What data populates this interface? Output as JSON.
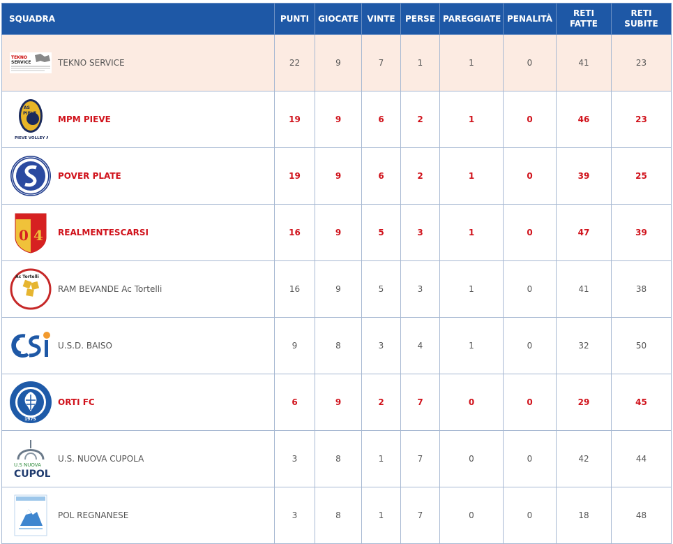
{
  "headers": {
    "team": "SQUADRA",
    "punti": "PUNTI",
    "giocate": "GIOCATE",
    "vinte": "VINTE",
    "perse": "PERSE",
    "pareggiate": "PAREGGIATE",
    "penalita": "PENALITÀ",
    "reti_fatte_1": "RETI",
    "reti_fatte_2": "FATTE",
    "reti_subite_1": "RETI",
    "reti_subite_2": "SUBITE"
  },
  "rows": [
    {
      "team": "TEKNO SERVICE",
      "logo": "tekno-service-logo",
      "punti": "22",
      "giocate": "9",
      "vinte": "7",
      "perse": "1",
      "pareggiate": "1",
      "penalita": "0",
      "reti_fatte": "41",
      "reti_subite": "23",
      "logo_text": "TEKNO SERVICE"
    },
    {
      "team": "MPM PIEVE",
      "logo": "pieve-volley-logo",
      "punti": "19",
      "giocate": "9",
      "vinte": "6",
      "perse": "2",
      "pareggiate": "1",
      "penalita": "0",
      "reti_fatte": "46",
      "reti_subite": "23",
      "logo_text": "PIEVE VOLLEY A.S.D."
    },
    {
      "team": "POVER PLATE",
      "logo": "pover-plate-logo",
      "punti": "19",
      "giocate": "9",
      "vinte": "6",
      "perse": "2",
      "pareggiate": "1",
      "penalita": "0",
      "reti_fatte": "39",
      "reti_subite": "25",
      "logo_text": ""
    },
    {
      "team": "REALMENTESCARSI",
      "logo": "realmentescarsi-logo",
      "punti": "16",
      "giocate": "9",
      "vinte": "5",
      "perse": "3",
      "pareggiate": "1",
      "penalita": "0",
      "reti_fatte": "47",
      "reti_subite": "39",
      "logo_text": "04"
    },
    {
      "team": "RAM BEVANDE Ac Tortelli",
      "logo": "ac-tortelli-logo",
      "punti": "16",
      "giocate": "9",
      "vinte": "5",
      "perse": "3",
      "pareggiate": "1",
      "penalita": "0",
      "reti_fatte": "41",
      "reti_subite": "38",
      "logo_text": "Ac Tortelli"
    },
    {
      "team": "U.S.D. BAISO",
      "logo": "csi-logo",
      "punti": "9",
      "giocate": "8",
      "vinte": "3",
      "perse": "4",
      "pareggiate": "1",
      "penalita": "0",
      "reti_fatte": "32",
      "reti_subite": "50",
      "logo_text": ""
    },
    {
      "team": "ORTI FC",
      "logo": "orti-fc-logo",
      "punti": "6",
      "giocate": "9",
      "vinte": "2",
      "perse": "7",
      "pareggiate": "0",
      "penalita": "0",
      "reti_fatte": "29",
      "reti_subite": "45",
      "logo_text": "1975"
    },
    {
      "team": "U.S. NUOVA CUPOLA",
      "logo": "nuova-cupola-logo",
      "punti": "3",
      "giocate": "8",
      "vinte": "1",
      "perse": "7",
      "pareggiate": "0",
      "penalita": "0",
      "reti_fatte": "42",
      "reti_subite": "44",
      "logo_text": "U.S NUOVA CUPOLA"
    },
    {
      "team": "POL REGNANESE",
      "logo": "pol-regnanese-logo",
      "punti": "3",
      "giocate": "8",
      "vinte": "1",
      "perse": "7",
      "pareggiate": "0",
      "penalita": "0",
      "reti_fatte": "18",
      "reti_subite": "48",
      "logo_text": ""
    }
  ],
  "colors": {
    "header_bg": "#1e58a6",
    "highlight_row_bg": "#fcebe2",
    "bold_row_text": "#d0121b",
    "normal_text": "#555555",
    "border": "#a6b8d2"
  }
}
